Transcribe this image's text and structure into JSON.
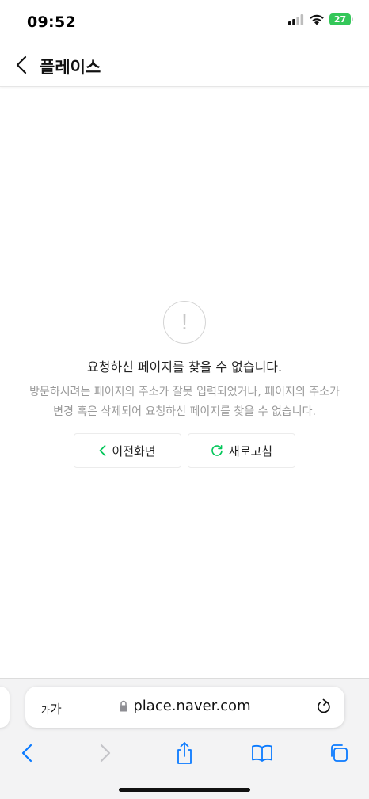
{
  "status_bar": {
    "time": "09:52",
    "battery_level": "27",
    "icons": [
      "cellular-signal-icon",
      "wifi-icon",
      "battery-icon"
    ]
  },
  "header": {
    "title": "플레이스",
    "back_icon": "chevron-left-icon"
  },
  "error": {
    "icon": "exclamation-icon",
    "title": "요청하신 페이지를 찾을 수 없습니다.",
    "description_line1": "방문하시려는 페이지의 주소가 잘못 입력되었거나, 페이지의 주소가",
    "description_line2": "변경 혹은 삭제되어 요청하신 페이지를 찾을 수 없습니다."
  },
  "actions": {
    "back_label": "이전화면",
    "refresh_label": "새로고침"
  },
  "browser": {
    "text_size_small": "가",
    "text_size_large": "가",
    "url": "place.naver.com",
    "toolbar_icons": [
      "back-icon",
      "forward-icon",
      "share-icon",
      "bookmarks-icon",
      "tabs-icon"
    ]
  },
  "colors": {
    "accent_green": "#03c75a",
    "safari_blue": "#0a7aff",
    "battery_green": "#34c759",
    "description_gray": "#9a9a9a"
  }
}
